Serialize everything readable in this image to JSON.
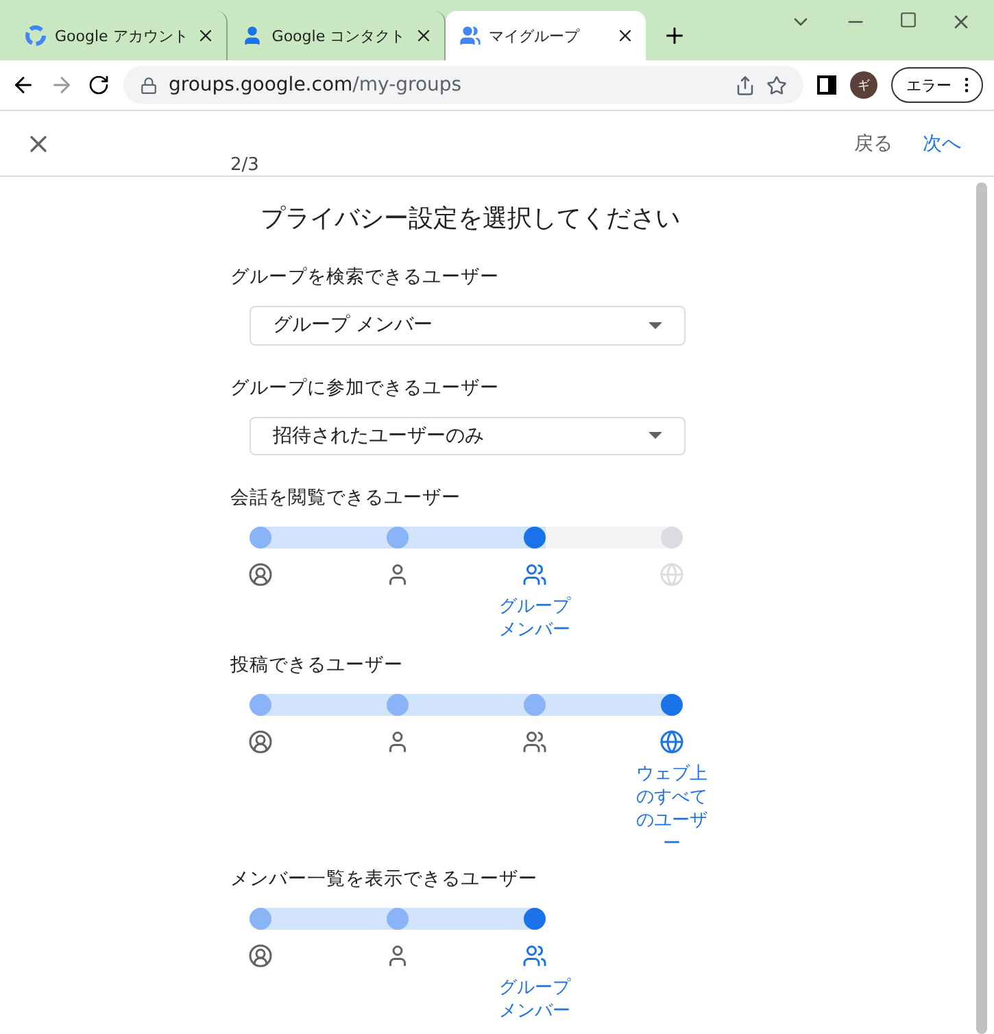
{
  "browser": {
    "tabs": [
      {
        "kind": "google",
        "title": "Google アカウント",
        "selected": false
      },
      {
        "kind": "person",
        "title": "Google コンタクト",
        "selected": false
      },
      {
        "kind": "group",
        "title": "マイグループ",
        "selected": true
      }
    ],
    "url_host": "groups.google.com",
    "url_path": "/my-groups",
    "profile_initial": "ギ",
    "error_button": "エラー"
  },
  "header": {
    "back": "戻る",
    "next": "次へ",
    "step": "2/3"
  },
  "title": "プライバシー設定を選択してください",
  "settings": [
    {
      "kind": "dropdown",
      "label": "グループを検索できるユーザー",
      "value": "グループ メンバー"
    },
    {
      "kind": "dropdown",
      "label": "グループに参加できるユーザー",
      "value": "招待されたユーザーのみ"
    },
    {
      "kind": "slider",
      "label": "会話を閲覧できるユーザー",
      "steps": [
        {
          "kind": "owner",
          "selected": false
        },
        {
          "kind": "manager",
          "selected": false
        },
        {
          "kind": "members",
          "selected": true,
          "caption": "グループメンバー"
        },
        {
          "kind": "web",
          "selected": false
        }
      ]
    },
    {
      "kind": "slider",
      "label": "投稿できるユーザー",
      "steps": [
        {
          "kind": "owner",
          "selected": false
        },
        {
          "kind": "manager",
          "selected": false
        },
        {
          "kind": "members",
          "selected": false
        },
        {
          "kind": "web",
          "selected": true,
          "caption": "ウェブ上のすべてのユーザー"
        }
      ]
    },
    {
      "kind": "slider",
      "label": "メンバー一覧を表示できるユーザー",
      "steps": [
        {
          "kind": "owner",
          "selected": false
        },
        {
          "kind": "manager",
          "selected": false
        },
        {
          "kind": "members",
          "selected": true,
          "caption": "グループメンバー"
        }
      ]
    }
  ]
}
